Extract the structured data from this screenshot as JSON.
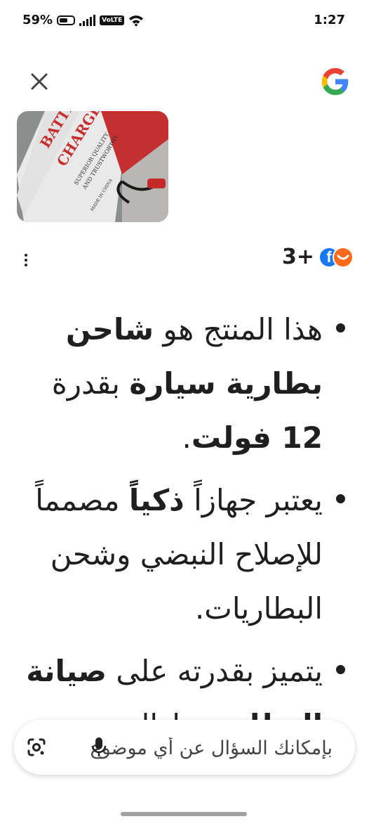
{
  "status_bar": {
    "battery": "59%",
    "battery_level": 0.59,
    "network_badge": "VoLTE",
    "time": "1:27"
  },
  "header": {
    "close_icon": "close-icon",
    "logo_icon": "google-g-logo"
  },
  "image": {
    "label_line1": "BATTERY",
    "label_line2": "CHARGER",
    "label_line3": "SUPERIOR QUALITY",
    "label_line4": "AND TRUSTWORTHY",
    "label_line5": "MADE IN CHINA"
  },
  "sources": {
    "count": "3+",
    "icons": [
      "facebook-icon",
      "aliexpress-icon"
    ]
  },
  "answer": {
    "bullets": [
      {
        "pre": "هذا المنتج هو ",
        "b1": "شاحن بطارية سيارة",
        "mid": " بقدرة ",
        "b2": "12 فولت",
        "post": "."
      },
      {
        "pre": "يعتبر جهازاً ",
        "b1": "ذكياً",
        "post": " مصمماً للإصلاح النبضي وشحن البطاريات."
      },
      {
        "pre": "يتميز بقدرته على ",
        "b1": "صيانة البطارية",
        "post": " وإزالة"
      }
    ]
  },
  "search": {
    "placeholder": "بإمكانك السؤال عن أي موضوع"
  },
  "colors": {
    "accent": "#1a73e8",
    "facebook": "#1877f2",
    "aliexpress": "#ff6a1a"
  }
}
